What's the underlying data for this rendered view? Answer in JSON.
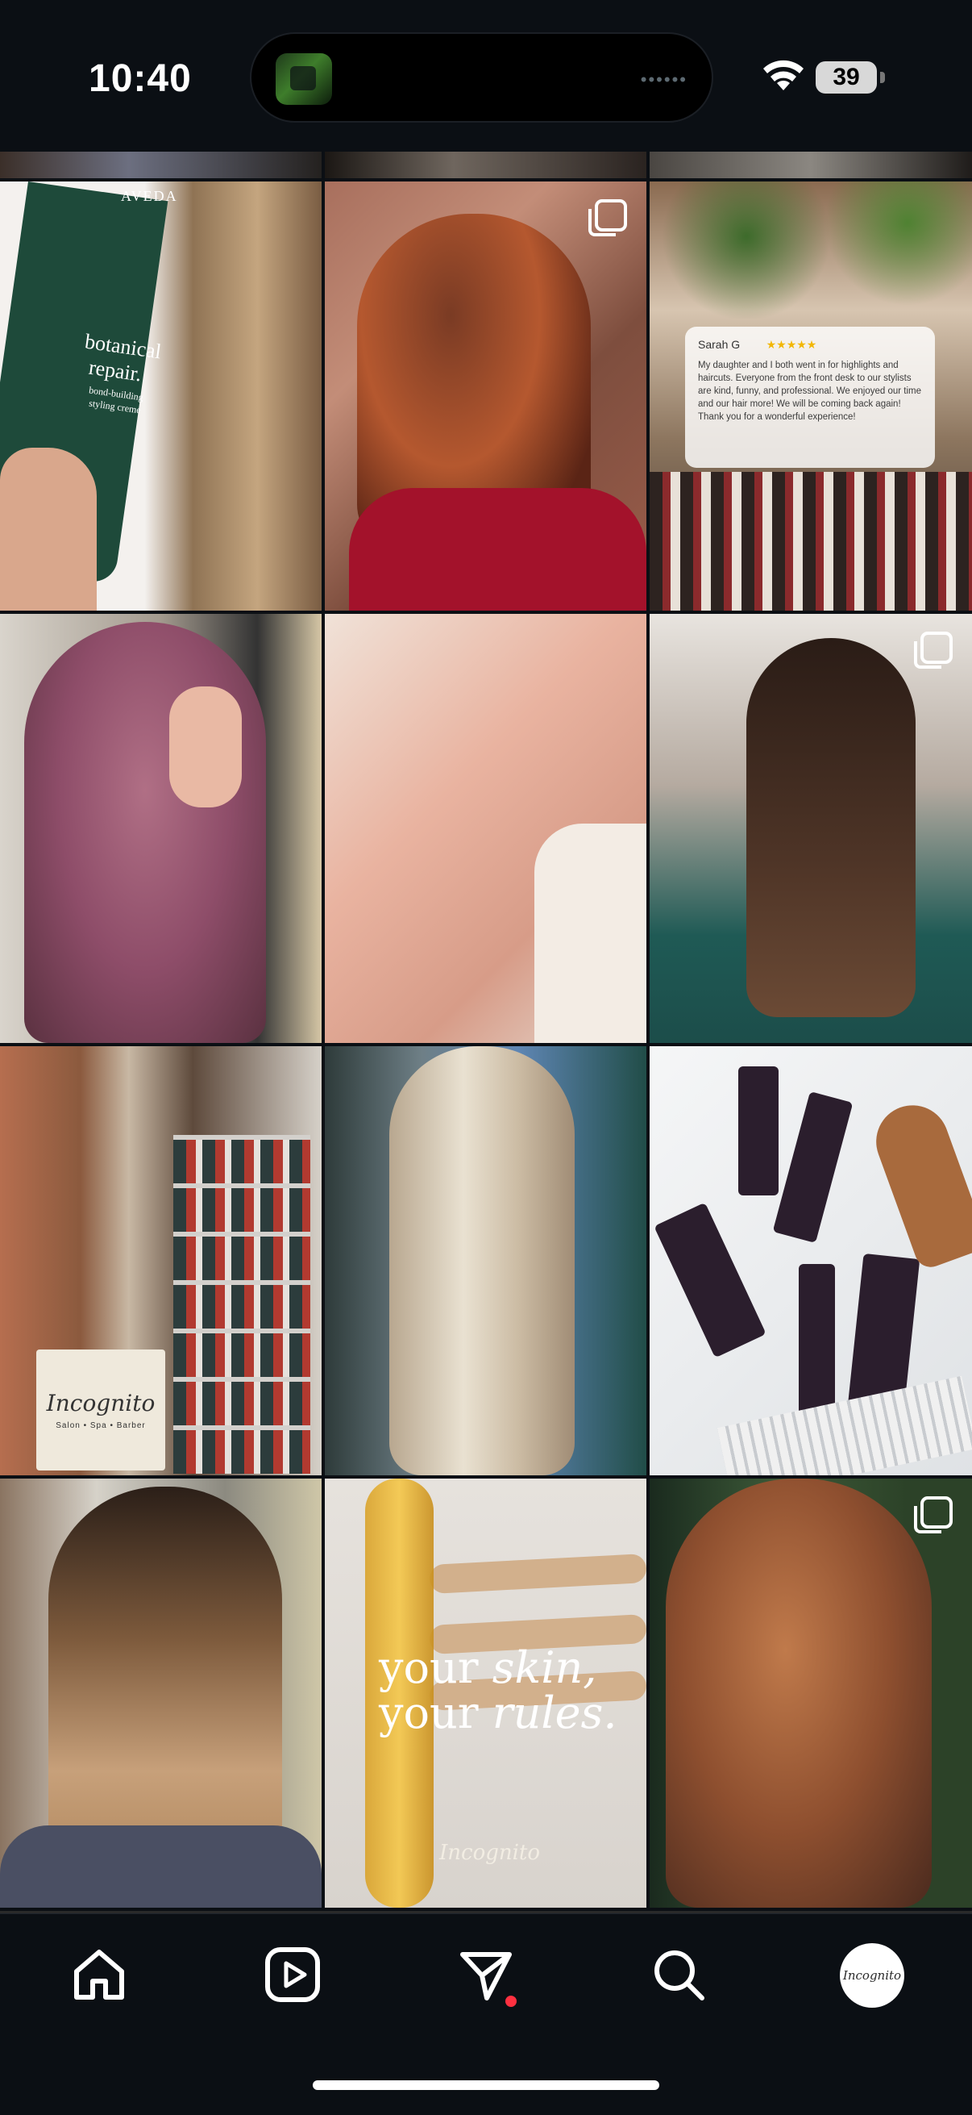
{
  "status_bar": {
    "time": "10:40",
    "battery": "39",
    "island_dots": "••••••"
  },
  "grid": {
    "tiles": [
      {
        "row": 1,
        "col": 1,
        "desc": "aveda-botanical-repair",
        "text": [
          "AVEDA",
          "botanical",
          "repair.",
          "bond-building",
          "styling creme"
        ],
        "multi": false
      },
      {
        "row": 1,
        "col": 2,
        "desc": "copper-waves",
        "multi": true
      },
      {
        "row": 1,
        "col": 3,
        "desc": "review-card",
        "multi": false
      },
      {
        "row": 2,
        "col": 1,
        "desc": "pink-hair",
        "multi": false
      },
      {
        "row": 2,
        "col": 2,
        "desc": "facial",
        "multi": false
      },
      {
        "row": 2,
        "col": 3,
        "desc": "brunette-balayage",
        "multi": true
      },
      {
        "row": 3,
        "col": 1,
        "desc": "salon-shelves-tote",
        "multi": false
      },
      {
        "row": 3,
        "col": 2,
        "desc": "blonde-waves",
        "multi": false
      },
      {
        "row": 3,
        "col": 3,
        "desc": "aveda-products",
        "multi": false
      },
      {
        "row": 4,
        "col": 1,
        "desc": "highlights",
        "multi": false
      },
      {
        "row": 4,
        "col": 2,
        "desc": "wax-promo",
        "multi": false
      },
      {
        "row": 4,
        "col": 3,
        "desc": "copper-balayage",
        "multi": true
      }
    ],
    "review": {
      "name": "Sarah G",
      "stars": "★★★★★",
      "body": "My daughter and I both went in for highlights and haircuts. Everyone from the front desk to our stylists are kind, funny, and professional. We enjoyed our time and our hair more! We will be coming back again! Thank you for a wonderful experience!"
    },
    "tote": {
      "brand": "Incognito",
      "sub": "Salon • Spa • Barber"
    },
    "wax": {
      "line1_a": "your ",
      "line1_b": "skin,",
      "line2_a": "your ",
      "line2_b": "rules.",
      "logo": "Incognito"
    }
  },
  "bottom_nav": {
    "items": [
      "home-icon",
      "reels-icon",
      "send-icon",
      "search-icon",
      "profile-avatar"
    ],
    "avatar_text": "Incognito"
  },
  "colors": {
    "background": "#0b0f14",
    "notification_dot": "#ff3040"
  }
}
